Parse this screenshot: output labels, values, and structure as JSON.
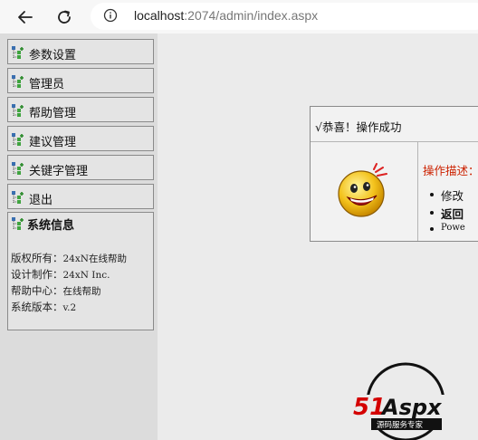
{
  "browser": {
    "url_host": "localhost",
    "url_rest": ":2074/admin/index.aspx"
  },
  "sidebar": {
    "items": [
      {
        "label": "参数设置"
      },
      {
        "label": "管理员"
      },
      {
        "label": "帮助管理"
      },
      {
        "label": "建议管理"
      },
      {
        "label": "关键字管理"
      },
      {
        "label": "退出"
      }
    ],
    "sysinfo": {
      "title": "系统信息",
      "rows": [
        {
          "label": "版权所有：",
          "value": "24xN在线帮助"
        },
        {
          "label": "设计制作：",
          "value": "24xN Inc."
        },
        {
          "label": "帮助中心：",
          "value": "在线帮助"
        },
        {
          "label": "系统版本：",
          "value": "v.2"
        }
      ]
    }
  },
  "message": {
    "title": "√恭喜！操作成功",
    "desc_label": "操作描述：",
    "bullets": [
      {
        "text": "修改"
      },
      {
        "text": "返回"
      },
      {
        "text": "Powe"
      }
    ]
  },
  "logo": {
    "brand": "51Aspx",
    "tagline": "源码服务专家"
  },
  "colors": {
    "accent_red": "#cc2200",
    "sidebar_bg": "#dcdcdc",
    "page_bg": "#ebebeb"
  }
}
